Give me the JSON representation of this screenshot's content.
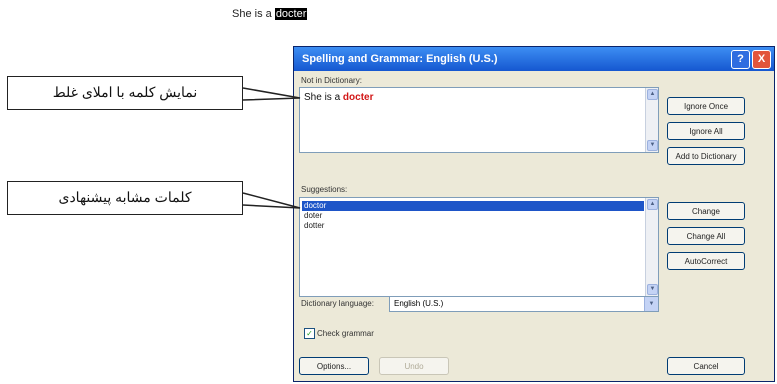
{
  "document": {
    "before": "She is a",
    "word": "docter"
  },
  "dialog": {
    "title": "Spelling and Grammar: English (U.S.)",
    "help_icon": "?",
    "close_icon": "X",
    "not_in_dictionary_label": "Not in Dictionary:",
    "sentence_before": "She is a ",
    "sentence_error": "docter",
    "buttons_top": [
      "Ignore Once",
      "Ignore All",
      "Add to Dictionary"
    ],
    "suggestions_label": "Suggestions:",
    "suggestions": [
      "doctor",
      "doter",
      "dotter"
    ],
    "buttons_mid": [
      "Change",
      "Change All",
      "AutoCorrect"
    ],
    "dictionary_language_label": "Dictionary language:",
    "dictionary_language_value": "English (U.S.)",
    "check_grammar_label": "Check grammar",
    "options_label": "Options...",
    "undo_label": "Undo",
    "cancel_label": "Cancel"
  },
  "callouts": {
    "misspelled": "نمایش کلمه با املای غلط",
    "suggestions": "کلمات مشابه پیشنهادی"
  },
  "colors": {
    "title_bar": "#1f63d6",
    "error_text": "#d21616",
    "selection": "#1e55c8"
  }
}
